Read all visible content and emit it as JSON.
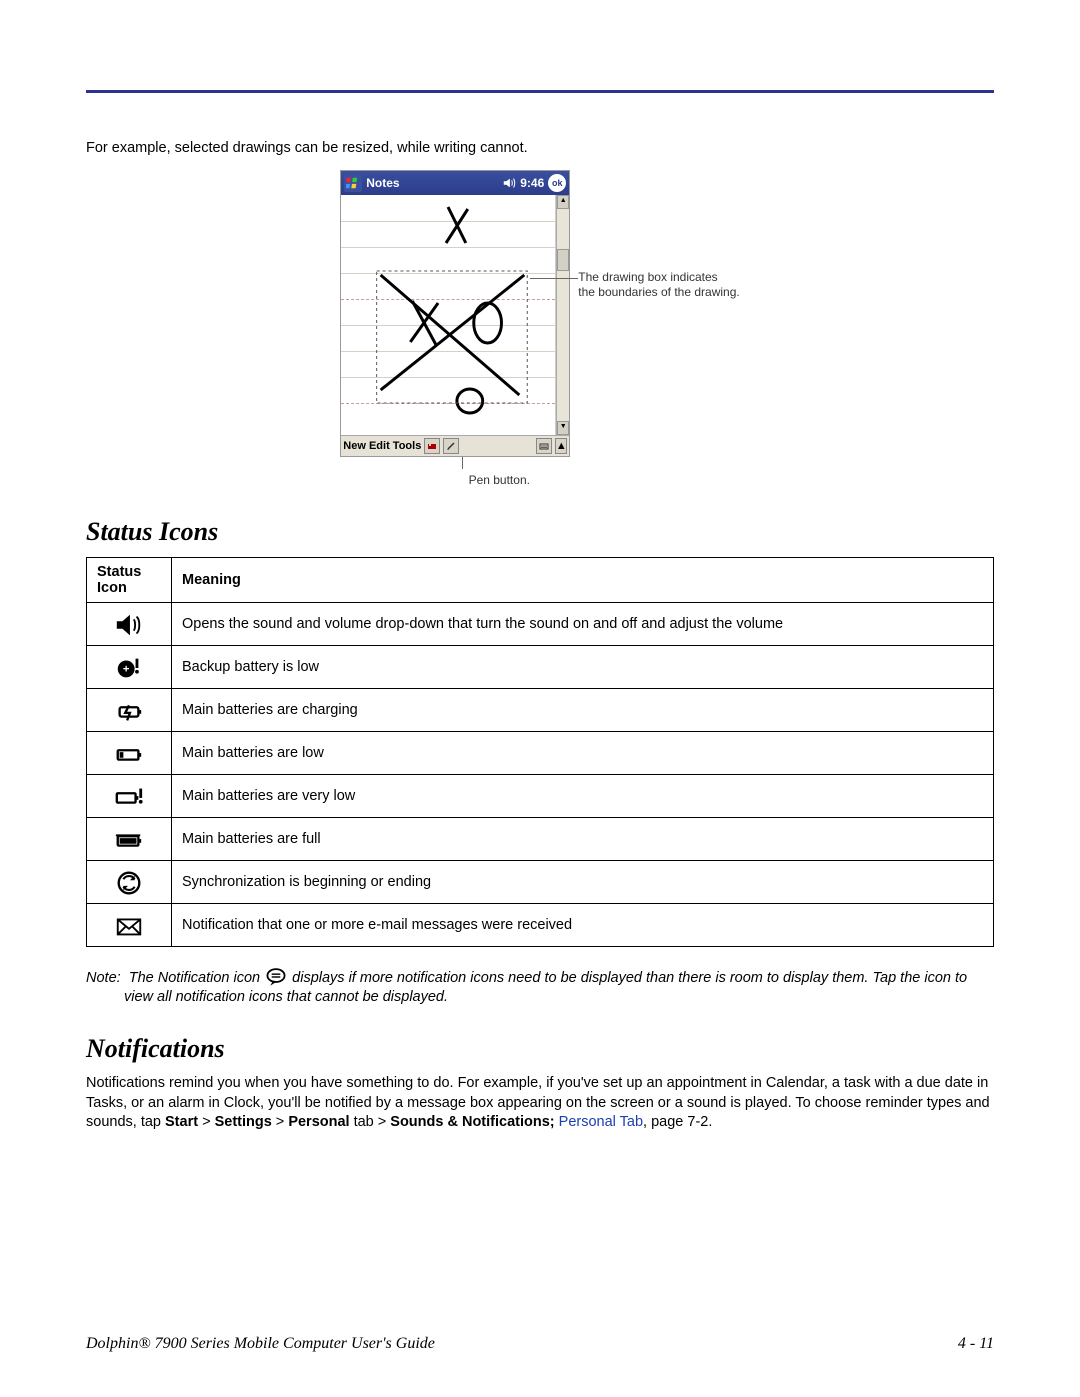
{
  "intro": "For example, selected drawings can be resized, while writing cannot.",
  "notesWindow": {
    "title": "Notes",
    "time": "9:46",
    "okLabel": "ok",
    "menu": {
      "new": "New",
      "edit": "Edit",
      "tools": "Tools"
    }
  },
  "callouts": {
    "drawingBox1": "The drawing box indicates",
    "drawingBox2": "the boundaries of the drawing.",
    "penButton": "Pen button."
  },
  "statusIconsHeading": "Status Icons",
  "tableHeaders": {
    "icon": "Status Icon",
    "meaning": "Meaning"
  },
  "statusIcons": [
    {
      "name": "speaker-icon",
      "meaning": "Opens the sound and volume drop-down that turn the sound on and off and adjust the volume"
    },
    {
      "name": "backup-battery-low-icon",
      "meaning": "Backup battery is low"
    },
    {
      "name": "battery-charging-icon",
      "meaning": "Main batteries are charging"
    },
    {
      "name": "battery-low-icon",
      "meaning": "Main batteries are low"
    },
    {
      "name": "battery-very-low-icon",
      "meaning": "Main batteries are very low"
    },
    {
      "name": "battery-full-icon",
      "meaning": "Main batteries are full"
    },
    {
      "name": "sync-icon",
      "meaning": "Synchronization is beginning or ending"
    },
    {
      "name": "mail-icon",
      "meaning": "Notification that one or more e-mail messages were received"
    }
  ],
  "note": {
    "prefix": "Note:",
    "text1": "The Notification icon",
    "text2": "displays if more notification icons need to be displayed than there is room to display them. Tap the icon to view all notification icons that cannot be displayed."
  },
  "notificationsHeading": "Notifications",
  "notificationsBody": {
    "text1": "Notifications remind you when you have something to do. For example, if you've set up an appointment in Calendar, a task with a due date in Tasks, or an alarm in Clock, you'll be notified by a message box appearing on the screen or a sound is played. To choose reminder types and sounds, tap ",
    "start": "Start",
    "gt": " > ",
    "settings": "Settings",
    "personalTab": "Personal",
    "tab": " tab > ",
    "sounds": "Sounds & Notifications;",
    "link": " Personal Tab",
    "pageRef": ", page 7-2."
  },
  "footer": {
    "left": "Dolphin® 7900 Series Mobile Computer User's Guide",
    "right": "4 - 11"
  }
}
